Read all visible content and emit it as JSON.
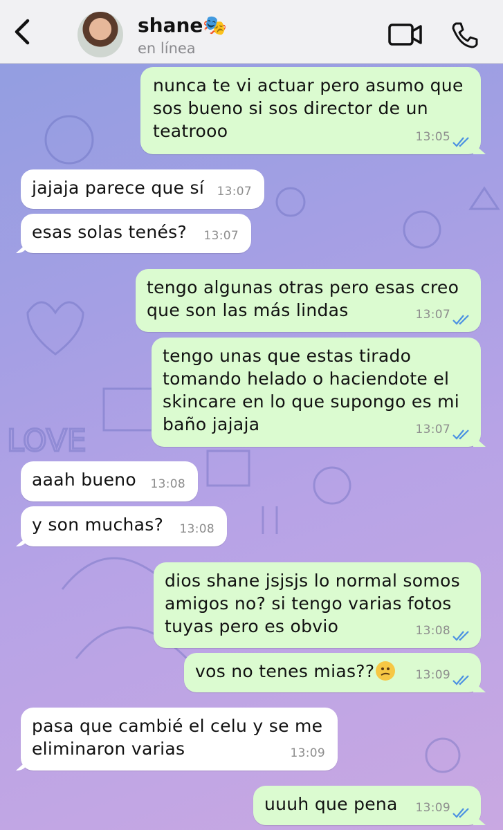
{
  "header": {
    "name": "shane🎭",
    "status": "en línea"
  },
  "messages": [
    {
      "dir": "out",
      "text": "nunca te vi actuar pero asumo que\nsos bueno si sos director de un\nteatrooo",
      "time": "13:05"
    },
    {
      "dir": "in",
      "text": "jajaja parece que sí",
      "time": "13:07"
    },
    {
      "dir": "in",
      "text": "esas solas tenés?",
      "time": "13:07"
    },
    {
      "dir": "out",
      "text": "tengo algunas otras pero esas creo\nque son las más lindas",
      "time": "13:07"
    },
    {
      "dir": "out",
      "text": "tengo unas que estas tirado\ntomando helado o haciendote el\nskincare en lo que supongo es mi\nbaño jajaja",
      "time": "13:07"
    },
    {
      "dir": "in",
      "text": "aaah bueno",
      "time": "13:08"
    },
    {
      "dir": "in",
      "text": "y son muchas?",
      "time": "13:08"
    },
    {
      "dir": "out",
      "text": "dios shane jsjsjs lo normal somos\namigos no? si tengo varias fotos\ntuyas pero es obvio",
      "time": "13:08"
    },
    {
      "dir": "out",
      "text": "vos no tenes mias??",
      "time": "13:09",
      "emoji": "confused-face"
    },
    {
      "dir": "in",
      "text": "pasa que cambié el celu y se me\neliminaron varias",
      "time": "13:09"
    },
    {
      "dir": "out",
      "text": "uuuh que pena",
      "time": "13:09"
    }
  ],
  "colors": {
    "incoming_bubble": "#ffffff",
    "outgoing_bubble": "#dbfbd0",
    "read_ticks": "#4a90e2",
    "header_bg": "#f1f1f3"
  }
}
